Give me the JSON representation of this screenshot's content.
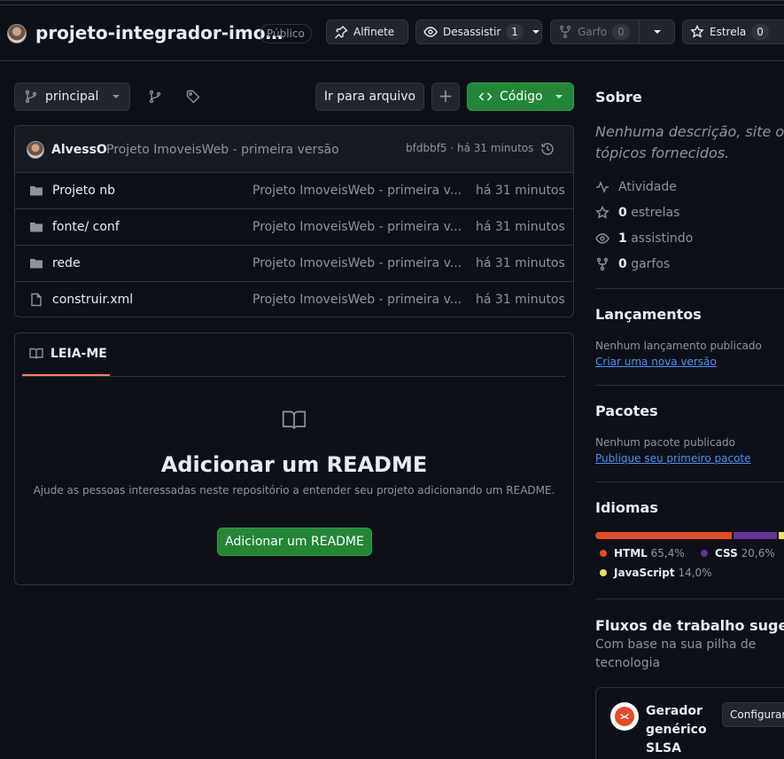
{
  "header": {
    "repo_name": "projeto-integrador-imo…",
    "visibility": "Público",
    "pin_label": "Alfinete",
    "unwatch_label": "Desassistir",
    "watch_count": "1",
    "fork_label": "Garfo",
    "fork_count": "0",
    "star_label": "Estrela",
    "star_count": "0"
  },
  "toolbar": {
    "branch": "principal",
    "go_to_file": "Ir para arquivo",
    "add": "+",
    "code": "Código"
  },
  "commit": {
    "author": "AlvessO",
    "message": "Projeto ImoveisWeb - primeira versão",
    "sha_time": "bfdbbf5 · há 31 minutos"
  },
  "files": [
    {
      "name": "Projeto nb",
      "type": "folder",
      "message": "Projeto ImoveisWeb - primeira v...",
      "time": "há 31 minutos"
    },
    {
      "name": "fonte/ conf",
      "type": "folder",
      "message": "Projeto ImoveisWeb - primeira v...",
      "time": "há 31 minutos"
    },
    {
      "name": "rede",
      "type": "folder",
      "message": "Projeto ImoveisWeb - primeira v...",
      "time": "há 31 minutos"
    },
    {
      "name": "construir.xml",
      "type": "file",
      "message": "Projeto ImoveisWeb - primeira v...",
      "time": "há 31 minutos"
    }
  ],
  "readme": {
    "tab": "LEIA-ME",
    "title": "Adicionar um README",
    "desc": "Ajude as pessoas interessadas neste repositório a entender seu projeto adicionando um README.",
    "button": "Adicionar um README"
  },
  "sidebar": {
    "about_title": "Sobre",
    "about_desc_1": "Nenhuma descrição, site ou",
    "about_desc_2": "tópicos fornecidos.",
    "activity": "Atividade",
    "stars_count": "0",
    "stars_label": "estrelas",
    "watching_count": "1",
    "watching_label": "assistindo",
    "forks_count": "0",
    "forks_label": "garfos",
    "releases_title": "Lançamentos",
    "releases_none": "Nenhum lançamento publicado",
    "releases_link": "Criar uma nova versão",
    "packages_title": "Pacotes",
    "packages_none": "Nenhum pacote publicado",
    "packages_link": "Publique seu primeiro pacote",
    "languages_title": "Idiomas",
    "languages": [
      {
        "name": "HTML",
        "pct": "65,4%",
        "value": 65.4,
        "color": "#e34c26"
      },
      {
        "name": "CSS",
        "pct": "20,6%",
        "value": 20.6,
        "color": "#663399"
      },
      {
        "name": "JavaScript",
        "pct": "14,0%",
        "value": 14.0,
        "color": "#f1e05a"
      }
    ],
    "workflows_title": "Fluxos de trabalho sugerido",
    "workflows_desc_1": "Com base na sua pilha de",
    "workflows_desc_2": "tecnologia",
    "workflow_name_1": "Gerador",
    "workflow_name_2": "genérico",
    "workflow_name_3": "SLSA",
    "workflow_button": "Configurar"
  }
}
